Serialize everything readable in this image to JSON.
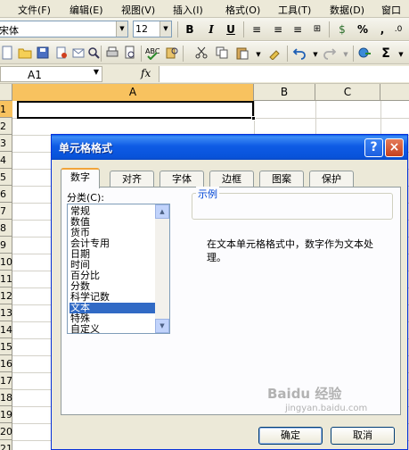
{
  "menubar": {
    "items": [
      "文件(F)",
      "编辑(E)",
      "视图(V)",
      "插入(I)",
      "格式(O)",
      "工具(T)",
      "数据(D)",
      "窗口"
    ]
  },
  "format_toolbar": {
    "font": "宋体",
    "size": "12",
    "bold": "B",
    "italic": "I",
    "underline": "U",
    "percent": "%",
    "comma": ","
  },
  "formula_bar": {
    "name_box": "A1",
    "fx": "fx"
  },
  "grid": {
    "columns": [
      "A",
      "B",
      "C"
    ],
    "rows": [
      "1",
      "2",
      "3",
      "4",
      "5",
      "6",
      "7",
      "8",
      "9",
      "10",
      "11",
      "12",
      "13",
      "14",
      "15",
      "16",
      "17",
      "18",
      "19",
      "20",
      "21"
    ]
  },
  "dialog": {
    "title": "单元格格式",
    "help": "?",
    "close": "×",
    "tabs": [
      "数字",
      "对齐",
      "字体",
      "边框",
      "图案",
      "保护"
    ],
    "category_label": "分类(C):",
    "categories": [
      "常规",
      "数值",
      "货币",
      "会计专用",
      "日期",
      "时间",
      "百分比",
      "分数",
      "科学记数",
      "文本",
      "特殊",
      "自定义"
    ],
    "selected_category": "文本",
    "example_label": "示例",
    "description": "在文本单元格格式中，数字作为文本处理。",
    "ok": "确定",
    "cancel": "取消"
  },
  "watermark": {
    "brand": "Baidu 经验",
    "url": "jingyan.baidu.com"
  },
  "colors": {
    "title_bar": "#0a5ee8",
    "selection": "#316ac5",
    "header_highlight": "#f8c25f",
    "close_button": "#c6401d"
  }
}
